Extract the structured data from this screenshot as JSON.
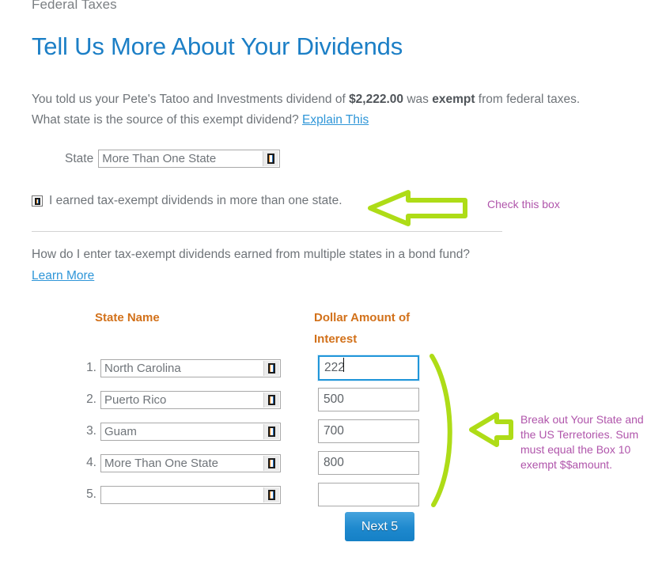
{
  "breadcrumb": "Federal Taxes",
  "page_title": "Tell Us More About Your Dividends",
  "intro": {
    "line1_a": "You told us your Pete's Tatoo and Investments dividend of ",
    "line1_amount": "$2,222.00",
    "line1_b": " was ",
    "line1_exempt": "exempt",
    "line1_c": " from federal taxes.",
    "line2_a": "What state is the source of this exempt dividend? ",
    "explain_link": "Explain This"
  },
  "state_field": {
    "label": "State",
    "value": "More Than One State",
    "dropdown_icon": "dropdown-tofu-icon"
  },
  "checkbox": {
    "label": "I earned tax-exempt dividends in more than one state.",
    "checked": true,
    "icon": "checkbox-tofu-icon"
  },
  "help": {
    "question": "How do I enter tax-exempt dividends earned from multiple states in a bond fund?",
    "learn_more": "Learn More"
  },
  "table": {
    "header_state": "State Name",
    "header_amount_line1": "Dollar Amount of",
    "header_amount_line2": "Interest",
    "rows": [
      {
        "num": "1.",
        "state": "North Carolina",
        "amount": "222",
        "focused": true
      },
      {
        "num": "2.",
        "state": "Puerto Rico",
        "amount": "500",
        "focused": false
      },
      {
        "num": "3.",
        "state": "Guam",
        "amount": "700",
        "focused": false
      },
      {
        "num": "4.",
        "state": "More Than One State",
        "amount": "800",
        "focused": false
      },
      {
        "num": "5.",
        "state": "",
        "amount": "",
        "focused": false
      }
    ]
  },
  "next_button": "Next 5",
  "annotations": {
    "check_this_box": "Check this box",
    "break_out": "Break out Your State and the US Terretories.  Sum must equal the Box 10 exempt $$amount."
  },
  "colors": {
    "title_blue": "#1c7fc6",
    "link_blue": "#2f96d8",
    "header_orange": "#d2711a",
    "annotation_purple": "#b055ab",
    "annotation_green": "#aedc17",
    "button_blue": "#1e89ce",
    "focus_blue": "#2196d9",
    "body_gray": "#6f7479"
  }
}
